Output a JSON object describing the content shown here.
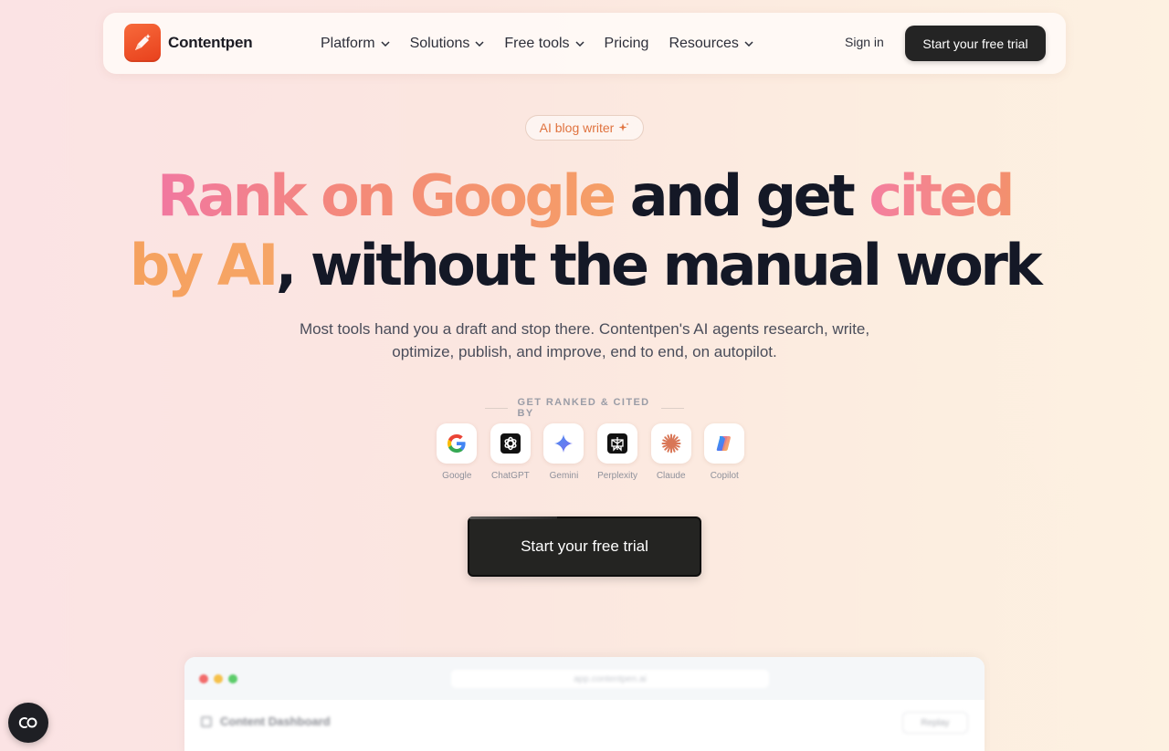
{
  "nav": {
    "brand": "Contentpen",
    "menu": [
      {
        "label": "Platform",
        "dropdown": true
      },
      {
        "label": "Solutions",
        "dropdown": true
      },
      {
        "label": "Free tools",
        "dropdown": true
      },
      {
        "label": "Pricing",
        "dropdown": false
      },
      {
        "label": "Resources",
        "dropdown": true
      }
    ],
    "sign_in": "Sign in",
    "cta": "Start your free trial"
  },
  "hero": {
    "badge": "AI blog writer",
    "headline": {
      "line1_part1": "Rank on Google",
      "line1_part2": "and get",
      "line1_part3": "cited",
      "line2_part1": "by AI",
      "line2_part2": ", without the manual work"
    },
    "subhead_line1": "Most tools hand you a draft and stop there. Contentpen's AI agents research, write,",
    "subhead_line2": "optimize, publish, and improve, end to end, on autopilot.",
    "ranked_label": "GET RANKED & CITED BY",
    "platforms": [
      {
        "name": "Google",
        "icon": "google-icon"
      },
      {
        "name": "ChatGPT",
        "icon": "chatgpt-icon"
      },
      {
        "name": "Gemini",
        "icon": "gemini-icon"
      },
      {
        "name": "Perplexity",
        "icon": "perplexity-icon"
      },
      {
        "name": "Claude",
        "icon": "claude-icon"
      },
      {
        "name": "Copilot",
        "icon": "copilot-icon"
      }
    ],
    "cta": "Start your free trial"
  },
  "preview": {
    "url": "app.contentpen.ai",
    "title": "Content Dashboard",
    "replay": "Replay"
  },
  "colors": {
    "accent": "#e8401c",
    "button_dark": "#242424",
    "headline_dark": "#141826"
  }
}
